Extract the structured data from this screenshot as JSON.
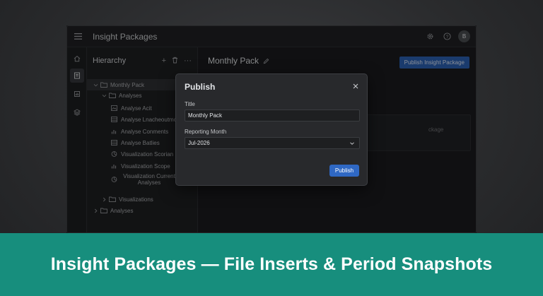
{
  "app": {
    "title": "Insight Packages",
    "avatar_initial": "B"
  },
  "panel": {
    "title": "Hierarchy",
    "actions": {
      "add": "+",
      "more": "···"
    },
    "tree": [
      {
        "label": "Monthly Pack",
        "type": "folder",
        "level": 0,
        "expanded": true,
        "selected": true
      },
      {
        "label": "Analyses",
        "type": "folder",
        "level": 1,
        "expanded": true
      },
      {
        "label": "Analyse Acit",
        "type": "image",
        "level": 2
      },
      {
        "label": "Analyse Lnacheoutmo",
        "type": "table",
        "level": 2
      },
      {
        "label": "Analyse Conments",
        "type": "bar-chart",
        "level": 2
      },
      {
        "label": "Analyse Batlies",
        "type": "table",
        "level": 2
      },
      {
        "label": "Visualization Scorian",
        "type": "pie",
        "level": 2
      },
      {
        "label": "Visualization Scope",
        "type": "bar-chart",
        "level": 2
      },
      {
        "label": "Visualization Current Analyses",
        "type": "pie",
        "level": 2
      },
      {
        "label": "Visualizations",
        "type": "folder",
        "level": 1,
        "expanded": false
      },
      {
        "label": "Analyses",
        "type": "folder",
        "level": 0,
        "expanded": false
      }
    ]
  },
  "main": {
    "title": "Monthly Pack",
    "publish_button": "Publish Insight Package",
    "background_text": "ckage"
  },
  "modal": {
    "title": "Publish",
    "title_label": "Title",
    "title_value": "Monthly Pack",
    "month_label": "Reporting Month",
    "month_value": "Jul-2026",
    "publish_button": "Publish"
  },
  "banner": {
    "text": "Insight Packages — File Inserts & Period Snapshots"
  },
  "colors": {
    "accent": "#2f68c4",
    "banner": "#178e7d"
  }
}
